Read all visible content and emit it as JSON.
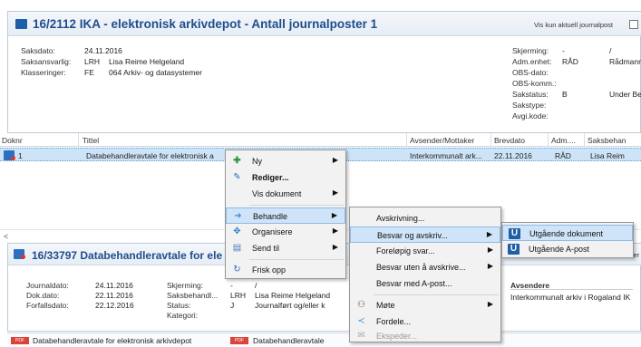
{
  "case": {
    "title": "16/2112 IKA  - elektronisk arkivdepot - Antall journalposter 1",
    "show_current_label": "Vis kun aktuell journalpost",
    "fields_left": [
      {
        "label": "Saksdato:",
        "code": "24.11.2016",
        "value": ""
      },
      {
        "label": "Saksansvarlig:",
        "code": "LRH",
        "value": "Lisa Reime Helgeland"
      },
      {
        "label": "Klasseringer:",
        "code": "FE",
        "value": "064   Arkiv- og datasystemer"
      }
    ],
    "fields_right": [
      {
        "label": "Skjerming:",
        "code": "-",
        "value": "/"
      },
      {
        "label": "Adm.enhet:",
        "code": "RÅD",
        "value": "Rådmann"
      },
      {
        "label": "OBS-dato:",
        "code": "",
        "value": ""
      },
      {
        "label": "OBS-komm.:",
        "code": "",
        "value": ""
      },
      {
        "label": "Sakstatus:",
        "code": "B",
        "value": "Under Be"
      },
      {
        "label": "Sakstype:",
        "code": "",
        "value": ""
      },
      {
        "label": "Avgi.kode:",
        "code": "",
        "value": ""
      }
    ]
  },
  "grid": {
    "columns": [
      "Doknr",
      "Tittel",
      "Avsender/Mottaker",
      "Brevdato",
      "Adm....",
      "Saksbehan"
    ],
    "row": {
      "doknr": "1",
      "tittel": "Databehandleravtale for elektronisk a",
      "avsender": "Interkommunalt ark...",
      "brevdato": "22.11.2016",
      "adm": "RÅD",
      "saksbehandler": "Lisa Reim"
    }
  },
  "doc": {
    "title": "16/33797  Databehandleravtale for ele",
    "title_right": "ler",
    "fields_left": [
      {
        "label": "Journaldato:",
        "value": "24.11.2016"
      },
      {
        "label": "Dok.dato:",
        "value": "22.11.2016"
      },
      {
        "label": "Forfallsdato:",
        "value": "22.12.2016"
      }
    ],
    "fields_mid": [
      {
        "label": "Skjerming:",
        "code": "-",
        "value": "/"
      },
      {
        "label": "Saksbehandl...",
        "code": "LRH",
        "value": "Lisa Reime Helgeland"
      },
      {
        "label": "Status:",
        "code": "J",
        "value": "Journalført og/eller k"
      },
      {
        "label": "Kategori:",
        "code": "",
        "value": ""
      }
    ],
    "senders_label": "Avsendere",
    "sender": "Interkommunalt arkiv i Rogaland IK"
  },
  "attachments": [
    {
      "icon": "PDF",
      "name": "Databehandleravtale for elektronisk arkivdepot"
    },
    {
      "icon": "PDF",
      "name": "Databehandleravtale"
    }
  ],
  "context_menu": {
    "items": [
      {
        "label": "Ny",
        "icon": "plus-icon",
        "submenu": true,
        "bold": false
      },
      {
        "label": "Rediger...",
        "icon": "pencil-icon",
        "submenu": false,
        "bold": true
      },
      {
        "label": "Vis dokument",
        "icon": "",
        "submenu": true,
        "bold": false
      },
      {
        "label": "Behandle",
        "icon": "process-icon",
        "submenu": true,
        "bold": false
      },
      {
        "label": "Organisere",
        "icon": "organize-icon",
        "submenu": true,
        "bold": false
      },
      {
        "label": "Send til",
        "icon": "send-icon",
        "submenu": true,
        "bold": false
      },
      {
        "label": "Frisk opp",
        "icon": "refresh-icon",
        "submenu": false,
        "bold": false
      }
    ]
  },
  "behandle_menu": {
    "items": [
      {
        "label": "Avskrivning...",
        "submenu": false
      },
      {
        "label": "Besvar og avskriv...",
        "submenu": true
      },
      {
        "label": "Foreløpig svar...",
        "submenu": true
      },
      {
        "label": "Besvar uten å avskrive...",
        "submenu": true
      },
      {
        "label": "Besvar med A-post...",
        "submenu": false
      },
      {
        "label": "Møte",
        "submenu": true
      },
      {
        "label": "Fordele...",
        "submenu": false
      },
      {
        "label": "Ekspeder...",
        "submenu": false
      }
    ]
  },
  "besvar_menu": {
    "items": [
      {
        "label": "Utgående dokument",
        "icon": "U"
      },
      {
        "label": "Utgående A-post",
        "icon": "U"
      }
    ]
  },
  "colors": {
    "title_blue": "#1f4e8c",
    "selection_blue": "#cde3f7",
    "menu_highlight": "#cfe4f8",
    "pdf_red": "#d9433a"
  }
}
